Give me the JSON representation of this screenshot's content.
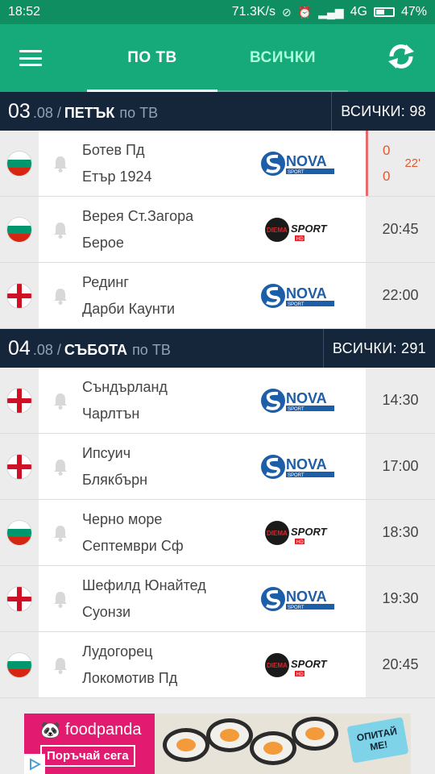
{
  "status": {
    "time": "18:52",
    "speed": "71.3K/s",
    "network": "4G",
    "battery": "47%",
    "battery_level": 0.47
  },
  "tabs": [
    {
      "label": "ПО ТВ",
      "active": true
    },
    {
      "label": "ВСИЧКИ",
      "active": false
    }
  ],
  "days": [
    {
      "day": "03",
      "month": ".08 /",
      "name": "ПЕТЪК",
      "suffix": "по ТВ",
      "all": "ВСИЧКИ: 98",
      "matches": [
        {
          "country": "bulgaria",
          "home": "Ботев Пд",
          "away": "Етър 1924",
          "channel": "nova-sport",
          "live": true,
          "score_home": "0",
          "score_away": "0",
          "minute": "22'"
        },
        {
          "country": "bulgaria",
          "home": "Верея Ст.Загора",
          "away": "Берое",
          "channel": "diema-sport",
          "time": "20:45"
        },
        {
          "country": "england",
          "home": "Рединг",
          "away": "Дарби Каунти",
          "channel": "nova-sport",
          "time": "22:00"
        }
      ]
    },
    {
      "day": "04",
      "month": ".08 /",
      "name": "СЪБОТА",
      "suffix": "по ТВ",
      "all": "ВСИЧКИ: 291",
      "matches": [
        {
          "country": "england",
          "home": "Съндърланд",
          "away": "Чарлтън",
          "channel": "nova-sport",
          "time": "14:30"
        },
        {
          "country": "england",
          "home": "Ипсуич",
          "away": "Блякбърн",
          "channel": "nova-sport",
          "time": "17:00"
        },
        {
          "country": "bulgaria",
          "home": "Черно море",
          "away": "Септември Сф",
          "channel": "diema-sport",
          "time": "18:30"
        },
        {
          "country": "england",
          "home": "Шефилд Юнайтед",
          "away": "Суонзи",
          "channel": "nova-sport",
          "time": "19:30"
        },
        {
          "country": "bulgaria",
          "home": "Лудогорец",
          "away": "Локомотив Пд",
          "channel": "diema-sport",
          "time": "20:45"
        }
      ]
    }
  ],
  "channels": {
    "nova-sport": {
      "top": "NOVA",
      "bottom": "SPORT"
    },
    "diema-sport": {
      "left": "DIEMA",
      "right": "SPORT",
      "badge": "HD"
    }
  },
  "ad": {
    "brand": "foodpanda",
    "cta": "Поръчай сега",
    "bubble": "ОПИТАЙ МЕ!"
  },
  "colors": {
    "status_bar": "#0f8f61",
    "app_bar": "#16a97a",
    "day_header": "#16263a",
    "live": "#e2572e"
  }
}
